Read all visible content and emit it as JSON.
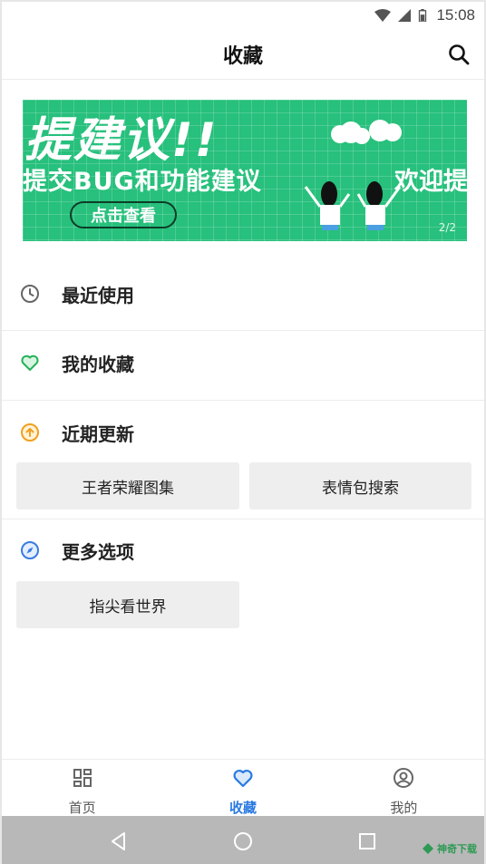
{
  "status_bar": {
    "time": "15:08"
  },
  "header": {
    "title": "收藏"
  },
  "banner": {
    "headline": "提建议!!",
    "subline": "提交BUG和功能建议",
    "subline_right": "欢迎提",
    "cta": "点击查看",
    "page_indicator": "2/2",
    "background_color": "#27c07c"
  },
  "sections": [
    {
      "label": "最近使用",
      "icon": "clock-icon"
    },
    {
      "label": "我的收藏",
      "icon": "heart-icon"
    },
    {
      "label": "近期更新",
      "icon": "arrow-up-circle-icon",
      "items": [
        "王者荣耀图集",
        "表情包搜索"
      ]
    },
    {
      "label": "更多选项",
      "icon": "compass-icon",
      "items": [
        "指尖看世界"
      ]
    }
  ],
  "bottom_nav": [
    {
      "label": "首页",
      "icon": "dashboard-icon",
      "active": false
    },
    {
      "label": "收藏",
      "icon": "heart-icon",
      "active": true
    },
    {
      "label": "我的",
      "icon": "user-circle-icon",
      "active": false
    }
  ],
  "watermark": "神奇下载",
  "colors": {
    "accent": "#2a7ae2",
    "heart_green": "#27b15a",
    "update_orange": "#f0a020",
    "banner_green": "#27c07c"
  }
}
